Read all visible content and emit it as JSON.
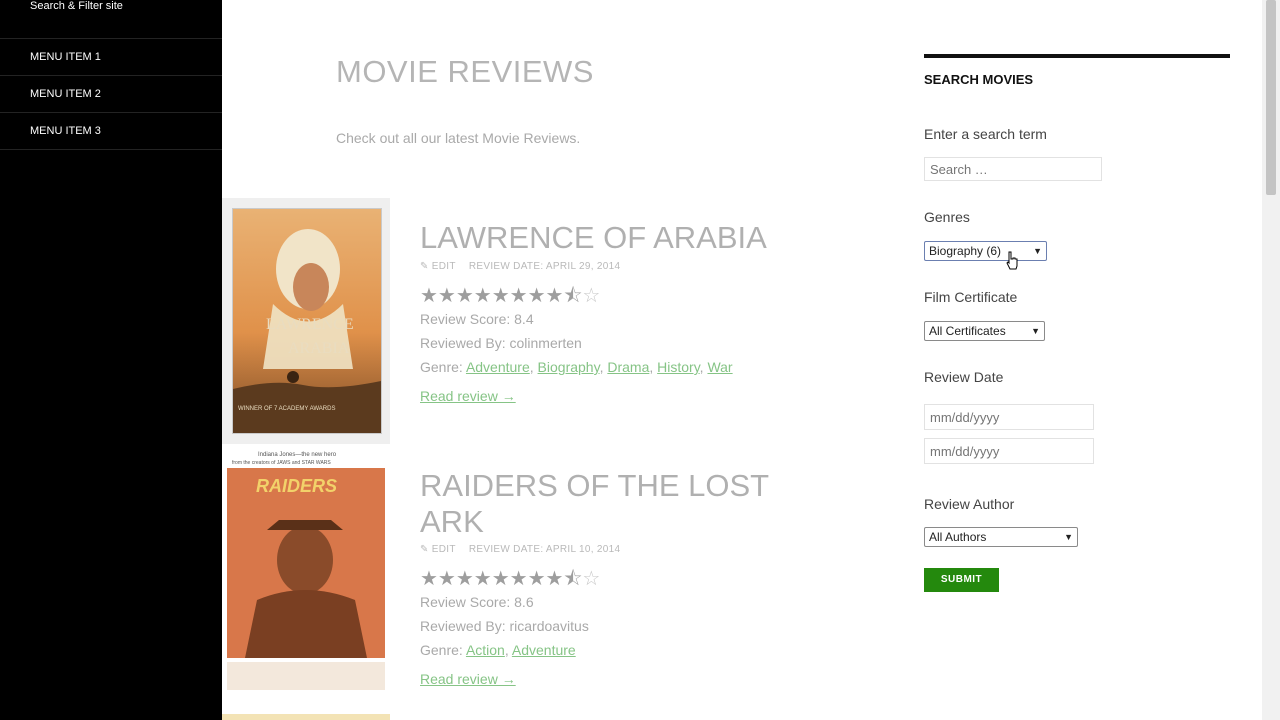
{
  "sidebar": {
    "search_label": "Search & Filter site",
    "items": [
      {
        "label": "MENU ITEM 1"
      },
      {
        "label": "MENU ITEM 2"
      },
      {
        "label": "MENU ITEM 3"
      }
    ]
  },
  "main": {
    "title": "MOVIE REVIEWS",
    "intro": "Check out all our latest Movie Reviews.",
    "reviews": [
      {
        "title": "LAWRENCE OF ARABIA",
        "edit_label": "EDIT",
        "review_date": "REVIEW DATE: APRIL 29, 2014",
        "rating": 8.4,
        "score_text": "Review Score: 8.4",
        "reviewed_by": "Reviewed By: colinmerten",
        "genre_label": "Genre:",
        "genres": [
          "Adventure",
          "Biography",
          "Drama",
          "History",
          "War"
        ],
        "read_more": "Read review →",
        "poster_text": [
          "LAWRENCE",
          "ARABIA",
          "WINNER OF 7 ACADEMY AWARDS"
        ]
      },
      {
        "title": "RAIDERS OF THE LOST ARK",
        "edit_label": "EDIT",
        "review_date": "REVIEW DATE: APRIL 10, 2014",
        "rating": 8.6,
        "score_text": "Review Score: 8.6",
        "reviewed_by": "Reviewed By: ricardoavitus",
        "genre_label": "Genre:",
        "genres": [
          "Action",
          "Adventure"
        ],
        "read_more": "Read review →",
        "poster_text": [
          "Indiana Jones—the new hero",
          "from the creators of JAWS and STAR WARS",
          "RAIDERS"
        ]
      }
    ]
  },
  "widget": {
    "title": "SEARCH MOVIES",
    "search_label": "Enter a search term",
    "search_placeholder": "Search …",
    "genres_label": "Genres",
    "genres_value": "Biography  (6)",
    "certificate_label": "Film Certificate",
    "certificate_value": "All Certificates",
    "date_label": "Review Date",
    "date_placeholder_from": "mm/dd/yyyy",
    "date_placeholder_to": "mm/dd/yyyy",
    "author_label": "Review Author",
    "author_value": "All Authors",
    "submit_label": "SUBMIT"
  },
  "colors": {
    "accent_green": "#24890d",
    "link_green_faded": "#86c486",
    "sidebar_bg": "#000000"
  },
  "icons": [
    "pencil-icon",
    "star-icon",
    "select-arrow-icon",
    "cursor-icon"
  ]
}
